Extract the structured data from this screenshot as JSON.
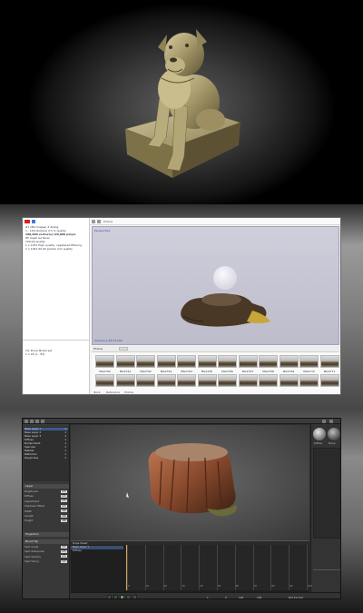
{
  "panels": [
    "hero-render",
    "photogrammetry-app",
    "texture-painting-app"
  ],
  "hero": {
    "subject": "bronze dog statue on square base",
    "background_color": "#000000"
  },
  "photogrammetry": {
    "log_lines": [
      "#1 (86 images) 4 dialog",
      "1 - 100 photo(s) 2.5 % quality",
      "100,000 vertex(s) (20,000 polys)",
      "85 mesh surfaces",
      "100.00 quality",
      "1 x 1181 High quality, registered filtering",
      "1 x 1181 90.00 points/ mm quality"
    ],
    "left_lower_lines": [
      "1/1 Done Model set",
      "1 x 18 (1 - 82)"
    ],
    "toolbar_label": "Photos",
    "viewport_label": "Perspective",
    "viewport_footer": "Camera 1:05 Fit 100",
    "photos_header": "Photos",
    "photos": [
      {
        "caption": "MG2760"
      },
      {
        "caption": "MG2761"
      },
      {
        "caption": "MG2762"
      },
      {
        "caption": "MG2763"
      },
      {
        "caption": "MG2764"
      },
      {
        "caption": "MG2765"
      },
      {
        "caption": "MG2766"
      },
      {
        "caption": "MG2767"
      },
      {
        "caption": "MG2768"
      },
      {
        "caption": "MG2769"
      },
      {
        "caption": "MG2770"
      },
      {
        "caption": "MG2771"
      }
    ],
    "status_items": [
      "Work",
      "Reference",
      "Photos"
    ],
    "colors": {
      "viewport": "#c5c4d2",
      "point_cloud": "#5a4732",
      "accent": "#3a4aa8"
    }
  },
  "painter": {
    "layers": [
      {
        "name": "Base Layer 1",
        "value": "1"
      },
      {
        "name": "Base Layer 2",
        "value": "1"
      },
      {
        "name": "Base Layer 3",
        "value": "1"
      },
      {
        "name": "Diffuse",
        "value": "1"
      },
      {
        "name": "Bumps Paint",
        "value": "1"
      },
      {
        "name": "Specular",
        "value": "1"
      },
      {
        "name": "Metallic",
        "value": "1"
      },
      {
        "name": "Reflection",
        "value": "1"
      },
      {
        "name": "Roughness",
        "value": "1"
      }
    ],
    "sections": [
      "Layer",
      "Projection",
      "Brush Tip"
    ],
    "properties": [
      {
        "name": "Brightness",
        "value": "0.5"
      },
      {
        "name": "Diffuse",
        "value": "0.5"
      },
      {
        "name": "Adjustment",
        "value": "0.5"
      },
      {
        "name": "Shadows Offset",
        "value": "0.5"
      },
      {
        "name": "Width",
        "value": "100"
      },
      {
        "name": "Length",
        "value": "100"
      },
      {
        "name": "Height",
        "value": "100"
      }
    ],
    "brush_properties": [
      {
        "name": "Spot Angle",
        "value": "0.5"
      },
      {
        "name": "Spot Sharpness",
        "value": "0.5"
      },
      {
        "name": "Spot Opacity",
        "value": "0.5"
      },
      {
        "name": "Spot Sizing",
        "value": "0.5"
      }
    ],
    "timeline_header": "Dope Sheet",
    "timeline_rows": [
      "Base Layer 1",
      "Diffuse"
    ],
    "frame_numbers": [
      "0",
      "10",
      "20",
      "30",
      "40",
      "50",
      "60",
      "70",
      "80",
      "90",
      "100"
    ],
    "bottom_bar": {
      "frame": "1",
      "start": "0",
      "end": "100",
      "length": "100",
      "fps": "Not Synced"
    },
    "right_panel_labels": [
      "Diffuse",
      "Bump"
    ],
    "colors": {
      "viewport": "#5a5a5a",
      "panel": "#383838",
      "stump": "#8a4a2e"
    }
  }
}
